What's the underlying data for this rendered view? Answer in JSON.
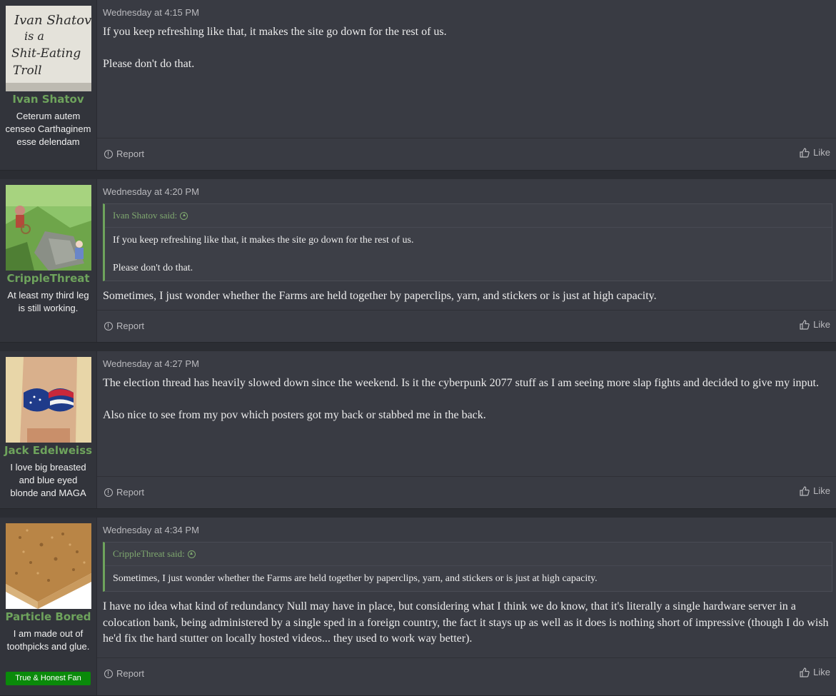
{
  "posts": [
    {
      "user": {
        "name": "Ivan Shatov",
        "title": "Ceterum autem censeo Carthaginem esse delendam",
        "avatar": "sign-avatar",
        "avatar_text": [
          "Ivan Shatov",
          "is a",
          "Shit-Eating",
          "Troll"
        ]
      },
      "time": "Wednesday at 4:15 PM",
      "body": [
        "If you keep refreshing like that, it makes the site go down for the rest of us.",
        "Please don't do that."
      ],
      "report": "Report",
      "like": "Like"
    },
    {
      "user": {
        "name": "CrippleThreat",
        "title": "At least my third leg is still working.",
        "avatar": "cartoon-cliff-avatar"
      },
      "time": "Wednesday at 4:20 PM",
      "quote": {
        "author": "Ivan Shatov said:",
        "lines": [
          "If you keep refreshing like that, it makes the site go down for the rest of us.",
          "Please don't do that."
        ]
      },
      "body": [
        "Sometimes, I just wonder whether the Farms are held together by paperclips, yarn, and stickers or is just at high capacity."
      ],
      "report": "Report",
      "like": "Like"
    },
    {
      "user": {
        "name": "Jack Edelweiss",
        "title": "I love big breasted and blue eyed blonde and MAGA",
        "avatar": "flag-bikini-avatar"
      },
      "time": "Wednesday at 4:27 PM",
      "body": [
        "The election thread has heavily slowed down since the weekend. Is it the cyberpunk 2077 stuff as I am seeing more slap fights and decided to give my input.",
        "Also nice to see from my pov which posters got my back or stabbed me in the back."
      ],
      "report": "Report",
      "like": "Like"
    },
    {
      "user": {
        "name": "Particle Bored",
        "title": "I am made out of toothpicks and glue.",
        "badge": "True & Honest Fan",
        "avatar": "particleboard-avatar"
      },
      "time": "Wednesday at 4:34 PM",
      "quote": {
        "author": "CrippleThreat said:",
        "lines": [
          "Sometimes, I just wonder whether the Farms are held together by paperclips, yarn, and stickers or is just at high capacity."
        ]
      },
      "body": [
        "I have no idea what kind of redundancy Null may have in place, but considering what I think we do know, that it's literally a single hardware server in a colocation bank, being administered by a single sped in a foreign country, the fact it stays up as well as it does is nothing short of impressive (though I do wish he'd fix the hard stutter on locally hosted videos... they used to work way better)."
      ],
      "report": "Report",
      "like": "Like"
    }
  ]
}
